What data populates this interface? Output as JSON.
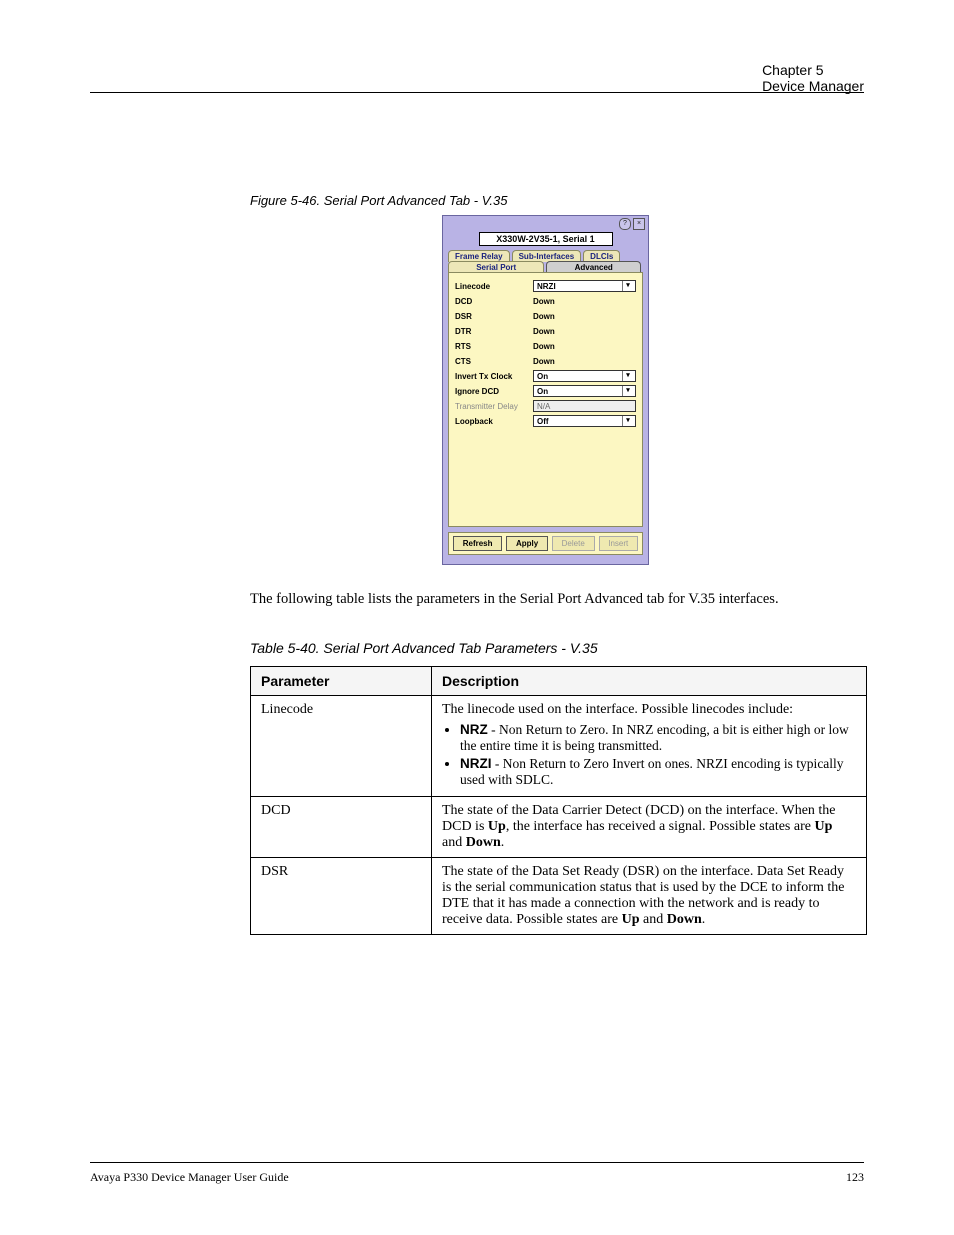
{
  "header": {
    "chapter": "Chapter 5",
    "title": "Device Manager"
  },
  "figure": {
    "caption": "Figure 5-46. Serial Port Advanced Tab - V.35"
  },
  "panel": {
    "device_title": "X330W-2V35-1, Serial 1",
    "tabs_row1": [
      "Frame Relay",
      "Sub-Interfaces",
      "DLCIs"
    ],
    "tabs_row2": [
      "Serial Port",
      "Advanced"
    ],
    "active_tab": "Advanced",
    "rows": [
      {
        "label": "Linecode",
        "type": "select",
        "value": "NRZI"
      },
      {
        "label": "DCD",
        "type": "static",
        "value": "Down"
      },
      {
        "label": "DSR",
        "type": "static",
        "value": "Down"
      },
      {
        "label": "DTR",
        "type": "static",
        "value": "Down"
      },
      {
        "label": "RTS",
        "type": "static",
        "value": "Down"
      },
      {
        "label": "CTS",
        "type": "static",
        "value": "Down"
      },
      {
        "label": "Invert Tx Clock",
        "type": "select",
        "value": "On"
      },
      {
        "label": "Ignore DCD",
        "type": "select",
        "value": "On"
      },
      {
        "label": "Transmitter Delay",
        "type": "readonly",
        "value": "N/A"
      },
      {
        "label": "Loopback",
        "type": "select",
        "value": "Off"
      }
    ],
    "buttons": [
      {
        "label": "Refresh",
        "enabled": true
      },
      {
        "label": "Apply",
        "enabled": true
      },
      {
        "label": "Delete",
        "enabled": false
      },
      {
        "label": "Insert",
        "enabled": false
      }
    ]
  },
  "body_para": "The following table lists the parameters in the Serial Port Advanced tab for V.35 interfaces.",
  "table_caption": "Table 5-40. Serial Port Advanced Tab Parameters - V.35",
  "table": {
    "headers": [
      "Parameter",
      "Description"
    ],
    "rows": [
      {
        "name": "Linecode",
        "desc": "The linecode used on the interface. Possible linecodes include:",
        "bullets": [
          {
            "b": "NRZ",
            "t": " - Non Return to Zero. In NRZ encoding, a bit is either high or low the entire time it is being transmitted."
          },
          {
            "b": "NRZI",
            "t": " - Non Return to Zero Invert on ones. NRZI encoding is typically used with SDLC."
          }
        ]
      },
      {
        "name": "DCD",
        "desc": "The state of the Data Carrier Detect (DCD) on the interface. When the DCD is ",
        "post": ", the interface has received a signal. Possible states are ",
        "bold1": "Up",
        "bold2": "Up",
        "bold3": "Down",
        "tail": " and "
      },
      {
        "name": "DSR",
        "desc": "The state of the Data Set Ready (DSR) on the interface. Data Set Ready is the serial communication status that is used by the DCE to inform the DTE that it has made a connection with the network and is ready to receive data. Possible states are ",
        "bold1": "Up",
        "bold2": "Down",
        "tail": " and "
      }
    ]
  },
  "footer": {
    "left": "Avaya P330 Device Manager User Guide",
    "right": "123"
  }
}
